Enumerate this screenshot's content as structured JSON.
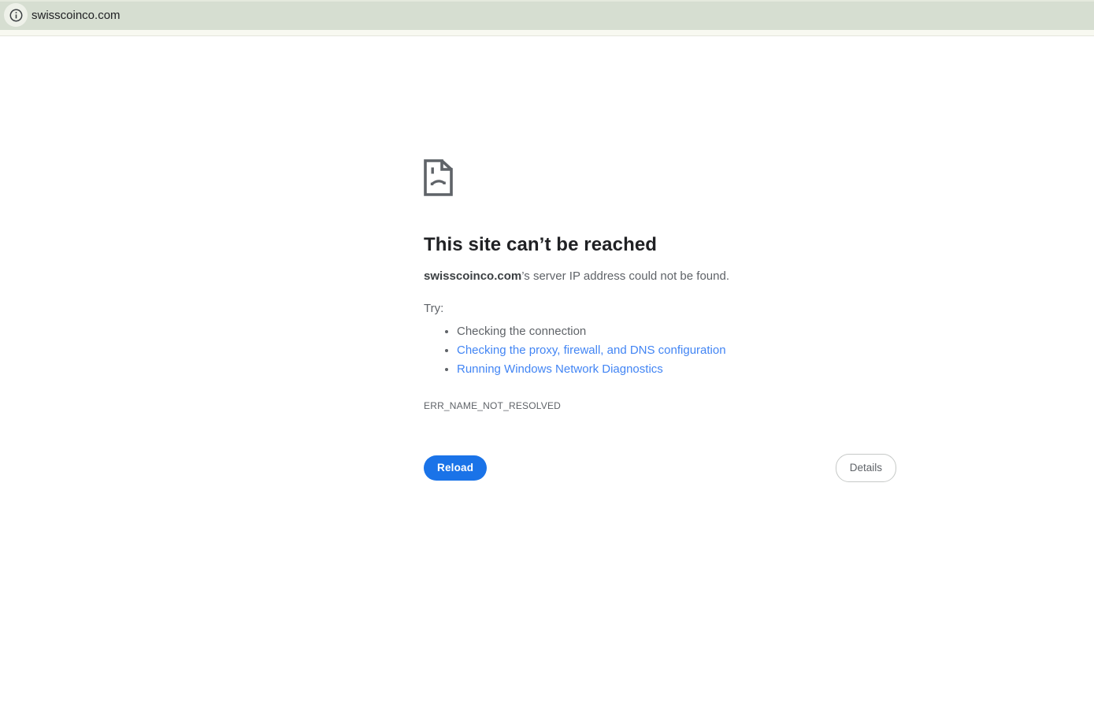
{
  "browser": {
    "address_bar": {
      "url": "swisscoinco.com"
    }
  },
  "error_page": {
    "title": "This site can’t be reached",
    "subtitle_domain": "swisscoinco.com",
    "subtitle_rest": "’s server IP address could not be found.",
    "try_label": "Try:",
    "suggestions": [
      {
        "label": "Checking the connection",
        "is_link": false
      },
      {
        "label": "Checking the proxy, firewall, and DNS configuration",
        "is_link": true
      },
      {
        "label": "Running Windows Network Diagnostics",
        "is_link": true
      }
    ],
    "error_code": "ERR_NAME_NOT_RESOLVED",
    "reload_label": "Reload",
    "details_label": "Details"
  },
  "icons": {
    "info_icon": "info-icon",
    "sad_page_icon": "sad-page-icon"
  },
  "colors": {
    "toolbar_background": "#d6ded1",
    "toolbar_substrip": "#f8f9f1",
    "link_blue": "#4285f4",
    "reload_button_blue": "#1a73e8",
    "heading_text": "#202124",
    "body_text": "#5f6368"
  }
}
